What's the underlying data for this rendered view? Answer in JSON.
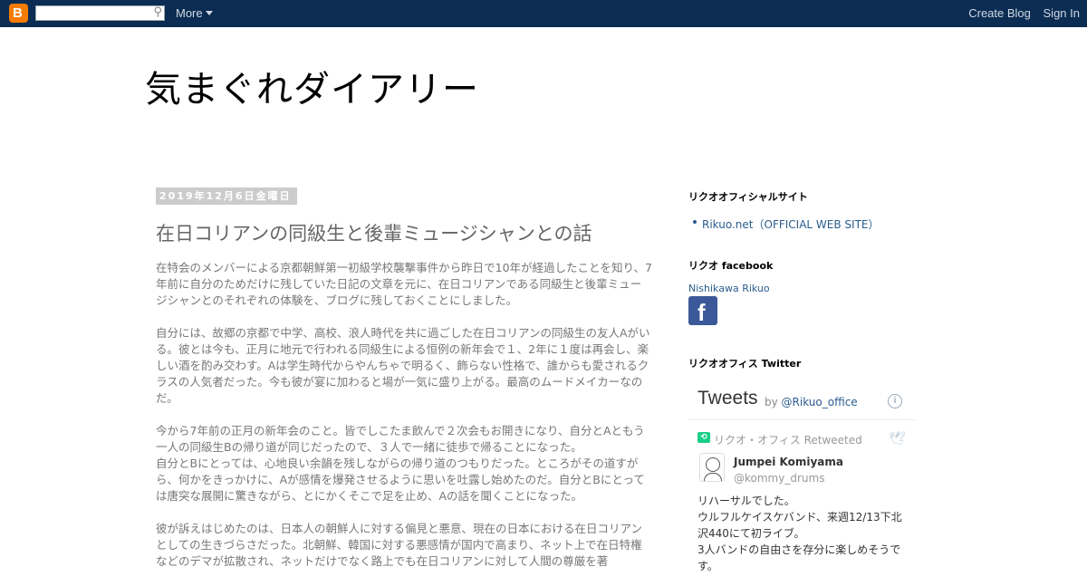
{
  "navbar": {
    "logo_letter": "B",
    "search_placeholder": "",
    "search_icon": "search-icon",
    "more_label": "More",
    "create_blog_label": "Create Blog",
    "sign_in_label": "Sign In",
    "bg_color": "#0c2d53",
    "logo_color": "#f57c00"
  },
  "header": {
    "title": "気まぐれダイアリー"
  },
  "post": {
    "date": "2019年12月6日金曜日",
    "title": "在日コリアンの同級生と後輩ミュージシャンとの話",
    "paragraphs": [
      "在特会のメンバーによる京都朝鮮第一初級学校襲撃事件から昨日で10年が経過したことを知り、7年前に自分のためだけに残していた日記の文章を元に、在日コリアンである同級生と後輩ミュージシャンとのそれぞれの体験を、ブログに残しておくことにしました。",
      "自分には、故郷の京都で中学、高校、浪人時代を共に過ごした在日コリアンの同級生の友人Aがいる。彼とは今も、正月に地元で行われる同級生による恒例の新年会で１、2年に１度は再会し、楽しい酒を酌み交わす。Aは学生時代からやんちゃで明るく、飾らない性格で、誰からも愛されるクラスの人気者だった。今も彼が宴に加わると場が一気に盛り上がる。最高のムードメイカーなのだ。",
      "今から7年前の正月の新年会のこと。皆でしこたま飲んで２次会もお開きになり、自分とAともう一人の同級生Bの帰り道が同じだったので、３人で一緒に徒歩で帰ることになった。\n自分とBにとっては、心地良い余韻を残しながらの帰り道のつもりだった。ところがその道すがら、何かをきっかけに、Aが感情を爆発させるように思いを吐露し始めたのだ。自分とBにとっては唐突な展開に驚きながら、とにかくそこで足を止め、Aの話を聞くことになった。",
      "彼が訴えはじめたのは、日本人の朝鮮人に対する偏見と悪意、現在の日本における在日コリアンとしての生きづらさだった。北朝鮮、韓国に対する悪感情が国内で高まり、ネット上で在日特権などのデマが拡散され、ネットだけでなく路上でも在日コリアンに対して人間の尊厳を著"
    ]
  },
  "sidebar": {
    "official_site": {
      "heading": "リクオオフィシャルサイト",
      "link": "Rikuo.net（OFFICIAL WEB SITE）"
    },
    "facebook": {
      "heading": "リクオ facebook",
      "name": "Nishikawa Rikuo",
      "badge_letter": "f",
      "badge_color": "#3b5998"
    },
    "twitter": {
      "heading": "リクオオフィス Twitter",
      "title": "Tweets",
      "by_label": "by",
      "account": "@Rikuo_office",
      "info_symbol": "i",
      "retweet_icon": "retweet-icon",
      "retweeted_by": "リクオ・オフィス Retweeted",
      "tweet_author": "Jumpei Komiyama",
      "tweet_handle": "@kommy_drums",
      "tweet_text": "リハーサルでした。\nウルフルケイスケバンド、来週12/13下北沢440にて初ライブ。\n3人バンドの自由さを存分に楽しめそうです。"
    }
  }
}
